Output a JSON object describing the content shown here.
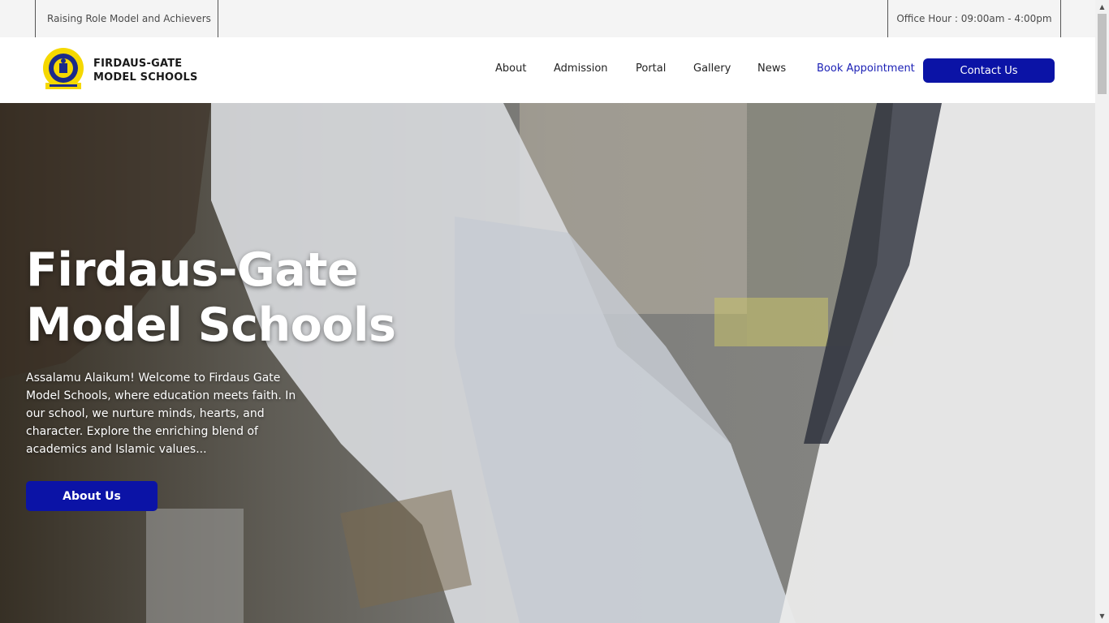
{
  "topbar": {
    "tagline": "Raising Role Model and Achievers",
    "office_hours": "Office Hour : 09:00am - 4:00pm"
  },
  "header": {
    "brand_line1": "FIRDAUS-GATE",
    "brand_line2": "MODEL SCHOOLS",
    "nav": [
      "About",
      "Admission",
      "Portal",
      "Gallery",
      "News"
    ],
    "book_label": "Book Appointment",
    "contact_label": "Contact Us"
  },
  "hero": {
    "title_line1": "Firdaus-Gate",
    "title_line2": "Model Schools",
    "intro": "Assalamu Alaikum! Welcome to Firdaus Gate Model Schools, where education meets faith. In our school, we nurture minds, hearts, and character. Explore the enriching blend of academics and Islamic values...",
    "cta_label": "About Us"
  },
  "colors": {
    "accent": "#0b13a6",
    "link": "#1a1fb5",
    "logo_yellow": "#f5d800",
    "logo_blue": "#1b2a8a"
  },
  "icons": {
    "logo": "school-crest-icon",
    "scroll_up": "chevron-up-icon",
    "scroll_down": "chevron-down-icon"
  }
}
